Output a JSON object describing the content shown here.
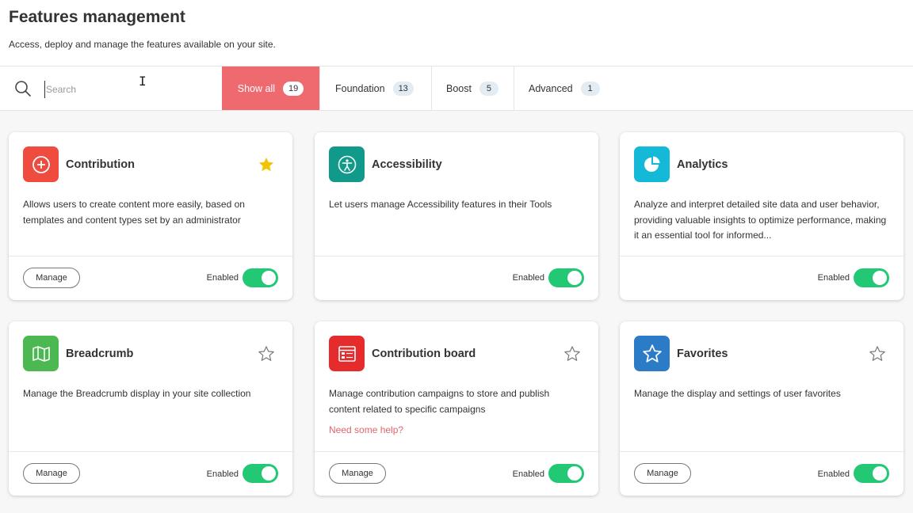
{
  "header": {
    "title": "Features management",
    "subtitle": "Access, deploy and manage the features available on your site."
  },
  "search": {
    "placeholder": "Search"
  },
  "tabs": [
    {
      "label": "Show all",
      "count": "19",
      "active": true
    },
    {
      "label": "Foundation",
      "count": "13"
    },
    {
      "label": "Boost",
      "count": "5"
    },
    {
      "label": "Advanced",
      "count": "1"
    }
  ],
  "cards": [
    {
      "title": "Contribution",
      "icon": "plus-circle-icon",
      "color": "#ef4b3f",
      "starred": true,
      "description": "Allows users to create content more easily, based on templates and content types set by an administrator",
      "manage_label": "Manage",
      "status": "Enabled"
    },
    {
      "title": "Accessibility",
      "icon": "accessibility-icon",
      "color": "#119a8a",
      "starred": false,
      "description": "Let users manage Accessibility features in their Tools",
      "status": "Enabled"
    },
    {
      "title": "Analytics",
      "icon": "pie-chart-icon",
      "color": "#13b9d6",
      "starred": false,
      "description": "Analyze and interpret detailed site data and user behavior, providing valuable insights to optimize performance, making it an essential tool for informed...",
      "status": "Enabled"
    },
    {
      "title": "Breadcrumb",
      "icon": "map-icon",
      "color": "#4cb852",
      "starred": false,
      "description": "Manage the Breadcrumb display in your site collection",
      "manage_label": "Manage",
      "status": "Enabled"
    },
    {
      "title": "Contribution board",
      "icon": "board-icon",
      "color": "#e52b2b",
      "starred": false,
      "description": "Manage contribution campaigns to store and publish content related to specific campaigns",
      "help_link": "Need some help?",
      "manage_label": "Manage",
      "status": "Enabled"
    },
    {
      "title": "Favorites",
      "icon": "star-icon",
      "color": "#2c7bc6",
      "starred": false,
      "description": "Manage the display and settings of user favorites",
      "manage_label": "Manage",
      "status": "Enabled"
    }
  ]
}
